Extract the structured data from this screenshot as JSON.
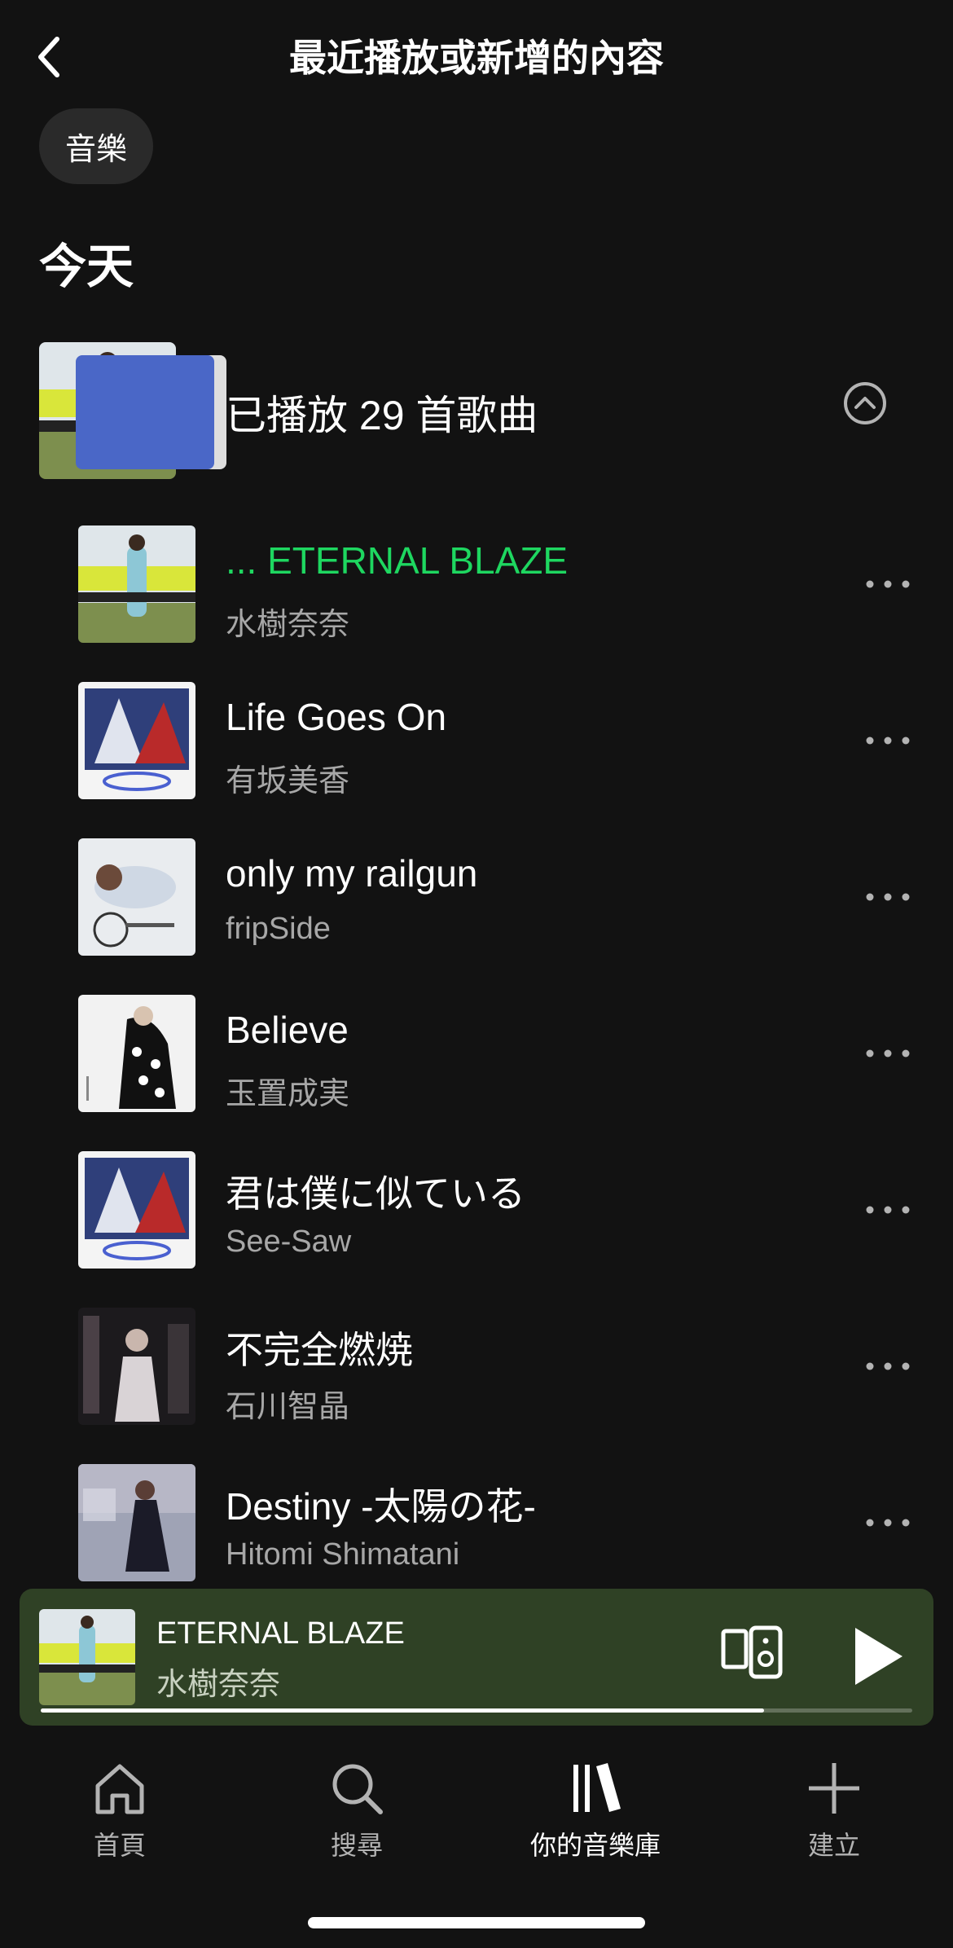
{
  "header": {
    "title": "最近播放或新增的內容"
  },
  "filter_chip": {
    "label": "音樂"
  },
  "section": {
    "title": "今天"
  },
  "group": {
    "label": "已播放 29 首歌曲"
  },
  "songs": [
    {
      "title": "... ETERNAL BLAZE",
      "artist": "水樹奈奈",
      "playing": true
    },
    {
      "title": "Life Goes On",
      "artist": "有坂美香"
    },
    {
      "title": "only my railgun",
      "artist": "fripSide"
    },
    {
      "title": "Believe",
      "artist": "玉置成実"
    },
    {
      "title": "君は僕に似ている",
      "artist": "See-Saw"
    },
    {
      "title": "不完全燃焼",
      "artist": "石川智晶"
    },
    {
      "title": "Destiny -太陽の花-",
      "artist": "Hitomi Shimatani"
    }
  ],
  "mini_player": {
    "title": "ETERNAL BLAZE",
    "artist": "水樹奈奈",
    "progress": 0.83
  },
  "tabs": [
    {
      "label": "首頁",
      "icon": "home-icon"
    },
    {
      "label": "搜尋",
      "icon": "search-icon"
    },
    {
      "label": "你的音樂庫",
      "icon": "library-icon",
      "active": true
    },
    {
      "label": "建立",
      "icon": "plus-icon"
    }
  ],
  "colors": {
    "background": "#121212",
    "accent": "#1ed760",
    "mini_player_bg": "#2f4125"
  }
}
